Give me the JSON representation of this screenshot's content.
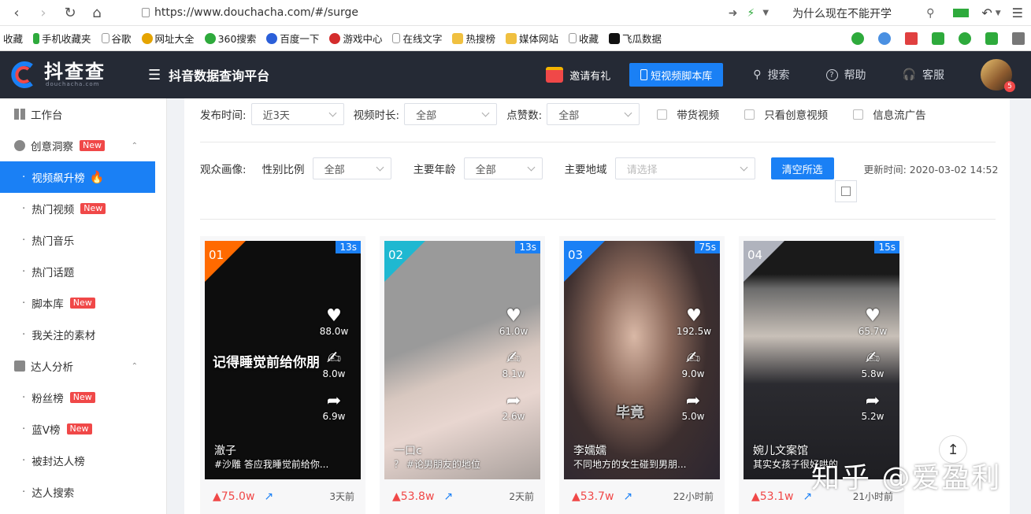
{
  "browser": {
    "url": "https://www.douchacha.com/#/surge",
    "search_text": "为什么现在不能开学",
    "bookmarks": [
      "收藏",
      "手机收藏夹",
      "谷歌",
      "网址大全",
      "360搜索",
      "百度一下",
      "游戏中心",
      "在线文字",
      "热搜榜",
      "媒体网站",
      "收藏",
      "飞瓜数据"
    ]
  },
  "header": {
    "logo_text": "抖查查",
    "logo_sub": "douchacha.com",
    "platform_title": "抖音数据查询平台",
    "invite_label": "邀请有礼",
    "script_lib_label": "短视频脚本库",
    "search_label": "搜索",
    "help_label": "帮助",
    "service_label": "客服",
    "avatar_badge": "5"
  },
  "sidebar": {
    "new_badge": "New",
    "items": [
      {
        "label": "工作台",
        "type": "group"
      },
      {
        "label": "创意洞察",
        "type": "group",
        "new": true
      },
      {
        "label": "视频飙升榜",
        "type": "sub",
        "active": true
      },
      {
        "label": "热门视频",
        "type": "sub",
        "new": true
      },
      {
        "label": "热门音乐",
        "type": "sub"
      },
      {
        "label": "热门话题",
        "type": "sub"
      },
      {
        "label": "脚本库",
        "type": "sub",
        "new": true
      },
      {
        "label": "我关注的素材",
        "type": "sub"
      },
      {
        "label": "达人分析",
        "type": "group"
      },
      {
        "label": "粉丝榜",
        "type": "sub",
        "new": true
      },
      {
        "label": "蓝V榜",
        "type": "sub",
        "new": true
      },
      {
        "label": "被封达人榜",
        "type": "sub"
      },
      {
        "label": "达人搜索",
        "type": "sub"
      }
    ]
  },
  "filters": {
    "publish_time_label": "发布时间:",
    "publish_time_value": "近3天",
    "duration_label": "视频时长:",
    "duration_value": "全部",
    "likes_label": "点赞数:",
    "likes_value": "全部",
    "cb_goods": "带货视频",
    "cb_creative": "只看创意视频",
    "cb_feed_ad": "信息流广告",
    "audience_label": "观众画像:",
    "gender_label": "性别比例",
    "gender_value": "全部",
    "age_label": "主要年龄",
    "age_value": "全部",
    "region_label": "主要地域",
    "region_placeholder": "请选择",
    "clear_label": "清空所选",
    "update_time": "更新时间: 2020-03-02 14:52"
  },
  "cards": [
    {
      "rank": "01",
      "duration": "13s",
      "likes": "88.0w",
      "comments": "8.0w",
      "shares": "6.9w",
      "author": "澈子",
      "desc": "#沙雕 答应我睡觉前给你...",
      "increase": "▲75.0w",
      "posted": "3天前",
      "caption": "记得睡觉前给你朋"
    },
    {
      "rank": "02",
      "duration": "13s",
      "likes": "61.0w",
      "comments": "8.1w",
      "shares": "2.6w",
      "author": "一口c",
      "desc": "？ #论男朋友的地位",
      "increase": "▲53.8w",
      "posted": "2天前",
      "caption": ""
    },
    {
      "rank": "03",
      "duration": "75s",
      "likes": "192.5w",
      "comments": "9.0w",
      "shares": "5.0w",
      "author": "李嬬嬬",
      "desc": "不同地方的女生碰到男朋...",
      "increase": "▲53.7w",
      "posted": "22小时前",
      "caption": "毕竟"
    },
    {
      "rank": "04",
      "duration": "15s",
      "likes": "65.7w",
      "comments": "5.8w",
      "shares": "5.2w",
      "author": "婉儿文案馆",
      "desc": "其实女孩子很好哄的",
      "increase": "▲53.1w",
      "posted": "21小时前",
      "caption": ""
    }
  ],
  "watermark": "知乎 @爱盈利",
  "colors": {
    "accent": "#1a80f5",
    "header_bg": "#252a35",
    "new_badge": "#f04848",
    "rank1": "#ff6a00",
    "rank2": "#1fb8d1",
    "rank3": "#1a80f5",
    "rank4": "#b0b3bd"
  }
}
